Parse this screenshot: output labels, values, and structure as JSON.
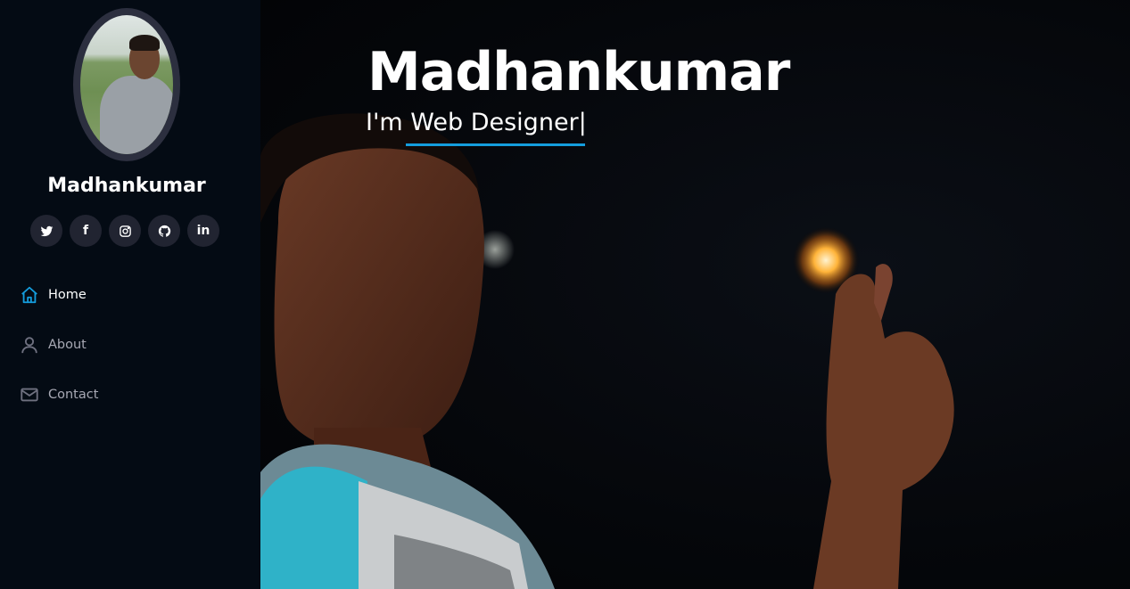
{
  "profile": {
    "name": "Madhankumar"
  },
  "social": [
    {
      "icon": "twitter-icon",
      "label": ""
    },
    {
      "icon": "facebook-icon",
      "label": "f"
    },
    {
      "icon": "instagram-icon",
      "label": ""
    },
    {
      "icon": "github-icon",
      "label": ""
    },
    {
      "icon": "linkedin-icon",
      "label": "in"
    }
  ],
  "nav": {
    "items": [
      {
        "label": "Home",
        "icon": "home-icon",
        "active": true
      },
      {
        "label": "About",
        "icon": "person-icon",
        "active": false
      },
      {
        "label": "Contact",
        "icon": "envelope-icon",
        "active": false
      }
    ]
  },
  "hero": {
    "title": "Madhankumar",
    "subtitle": "I'm Web Designer",
    "cursor": "|"
  },
  "colors": {
    "accent": "#149ddd",
    "sidebar_bg": "#040b14",
    "social_bg": "#212431",
    "nav_text": "#a8a9b4"
  }
}
